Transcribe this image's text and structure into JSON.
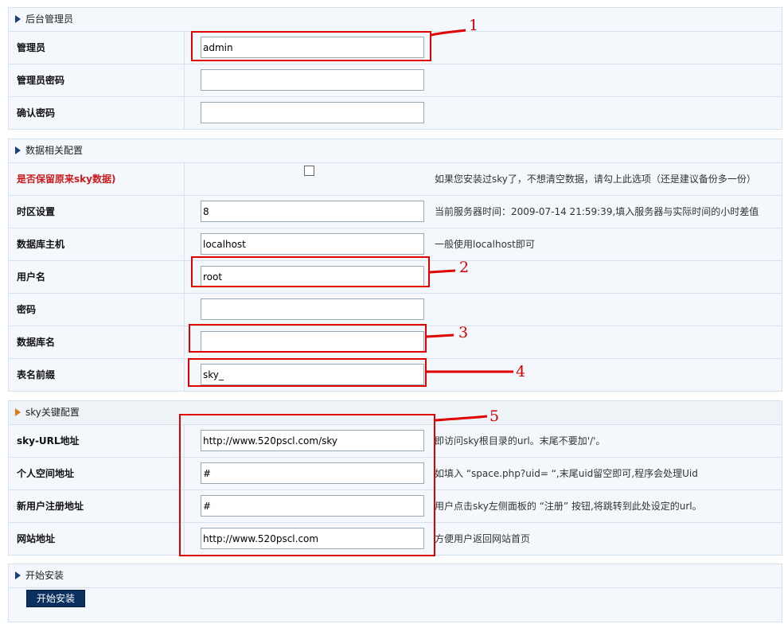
{
  "sections": {
    "admin": {
      "title": "后台管理员",
      "rows": [
        {
          "label": "管理员",
          "value": "admin"
        },
        {
          "label": "管理员密码",
          "value": ""
        },
        {
          "label": "确认密码",
          "value": ""
        }
      ]
    },
    "db": {
      "title": "数据相关配置",
      "keep": {
        "label": "是否保留原来sky数据)",
        "tip": "如果您安装过sky了，不想清空数据，请勾上此选项（还是建议备份多一份）"
      },
      "rows": [
        {
          "label": "时区设置",
          "value": "8",
          "tip": "当前服务器时间：2009-07-14 21:59:39,填入服务器与实际时间的小时差值"
        },
        {
          "label": "数据库主机",
          "value": "localhost",
          "tip": "一般使用localhost即可"
        },
        {
          "label": "用户名",
          "value": "root",
          "tip": ""
        },
        {
          "label": "密码",
          "value": "",
          "tip": ""
        },
        {
          "label": "数据库名",
          "value": "",
          "tip": ""
        },
        {
          "label": "表名前缀",
          "value": "sky_",
          "tip": ""
        }
      ]
    },
    "sky": {
      "title": "sky关键配置",
      "rows": [
        {
          "label": "sky-URL地址",
          "value": "http://www.520pscl.com/sky",
          "tip": "即访问sky根目录的url。末尾不要加'/'。"
        },
        {
          "label": "个人空间地址",
          "value": "#",
          "tip": "如填入 “space.php?uid= “,末尾uid留空即可,程序会处理Uid"
        },
        {
          "label": "新用户注册地址",
          "value": "#",
          "tip": "用户点击sky左侧面板的 “注册” 按钮,将跳转到此处设定的url。"
        },
        {
          "label": "网站地址",
          "value": "http://www.520pscl.com",
          "tip": "方便用户返回网站首页"
        }
      ]
    },
    "install": {
      "title": "开始安装",
      "button": "开始安装"
    }
  },
  "annotations": [
    "1",
    "2",
    "3",
    "4",
    "5"
  ],
  "colors": {
    "accent_red": "#e00000",
    "header_icon": "#1c3f78",
    "button_bg": "#0b2f5f"
  }
}
